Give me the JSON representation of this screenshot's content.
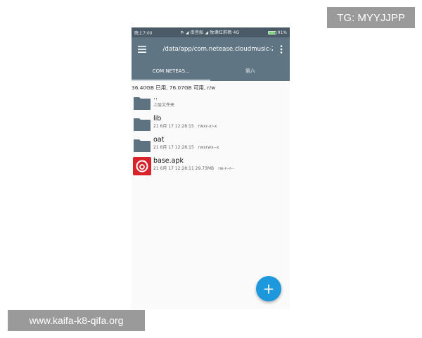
{
  "status_bar": {
    "time": "晚上7:00",
    "carrier_info": "⛈ ◢ 南音船 ◢ 牧濑红莉栖 4G",
    "battery": "91%",
    "battery_level": 0.91
  },
  "toolbar": {
    "path": "/data/app/com.netease.cloudmusic-2",
    "menu_icon": "hamburger-menu-icon",
    "more_icon": "more-vert-icon"
  },
  "tabs": [
    {
      "label": "COM.NETEAS...",
      "active": true
    },
    {
      "label": "第六",
      "active": false
    }
  ],
  "storage_info": "36.40GB 已用, 76.07GB 可用, r/w",
  "files": [
    {
      "name": "..",
      "meta": "上层文件夹",
      "perm": "",
      "icon": "folder-icon"
    },
    {
      "name": "lib",
      "meta": "21 6月 17 12:28:15",
      "perm": "rwxr-xr-x",
      "icon": "folder-icon"
    },
    {
      "name": "oat",
      "meta": "21 6月 17 12:28:15",
      "perm": "rwxrwx--x",
      "icon": "folder-icon"
    },
    {
      "name": "base.apk",
      "meta": "21 6月 17 12:28:11  29.73MB",
      "perm": "rw-r--r--",
      "icon": "netease-music-app-icon"
    }
  ],
  "fab": {
    "label": "+"
  },
  "watermarks": {
    "tg": "TG: MYYJJPP",
    "url": "www.kaifa-k8-qifa.org"
  },
  "colors": {
    "toolbar": "#5f7583",
    "status_bar": "#4a5a66",
    "fab": "#1e98dc",
    "folder": "#5d7381",
    "apk_red": "#d8232a"
  }
}
